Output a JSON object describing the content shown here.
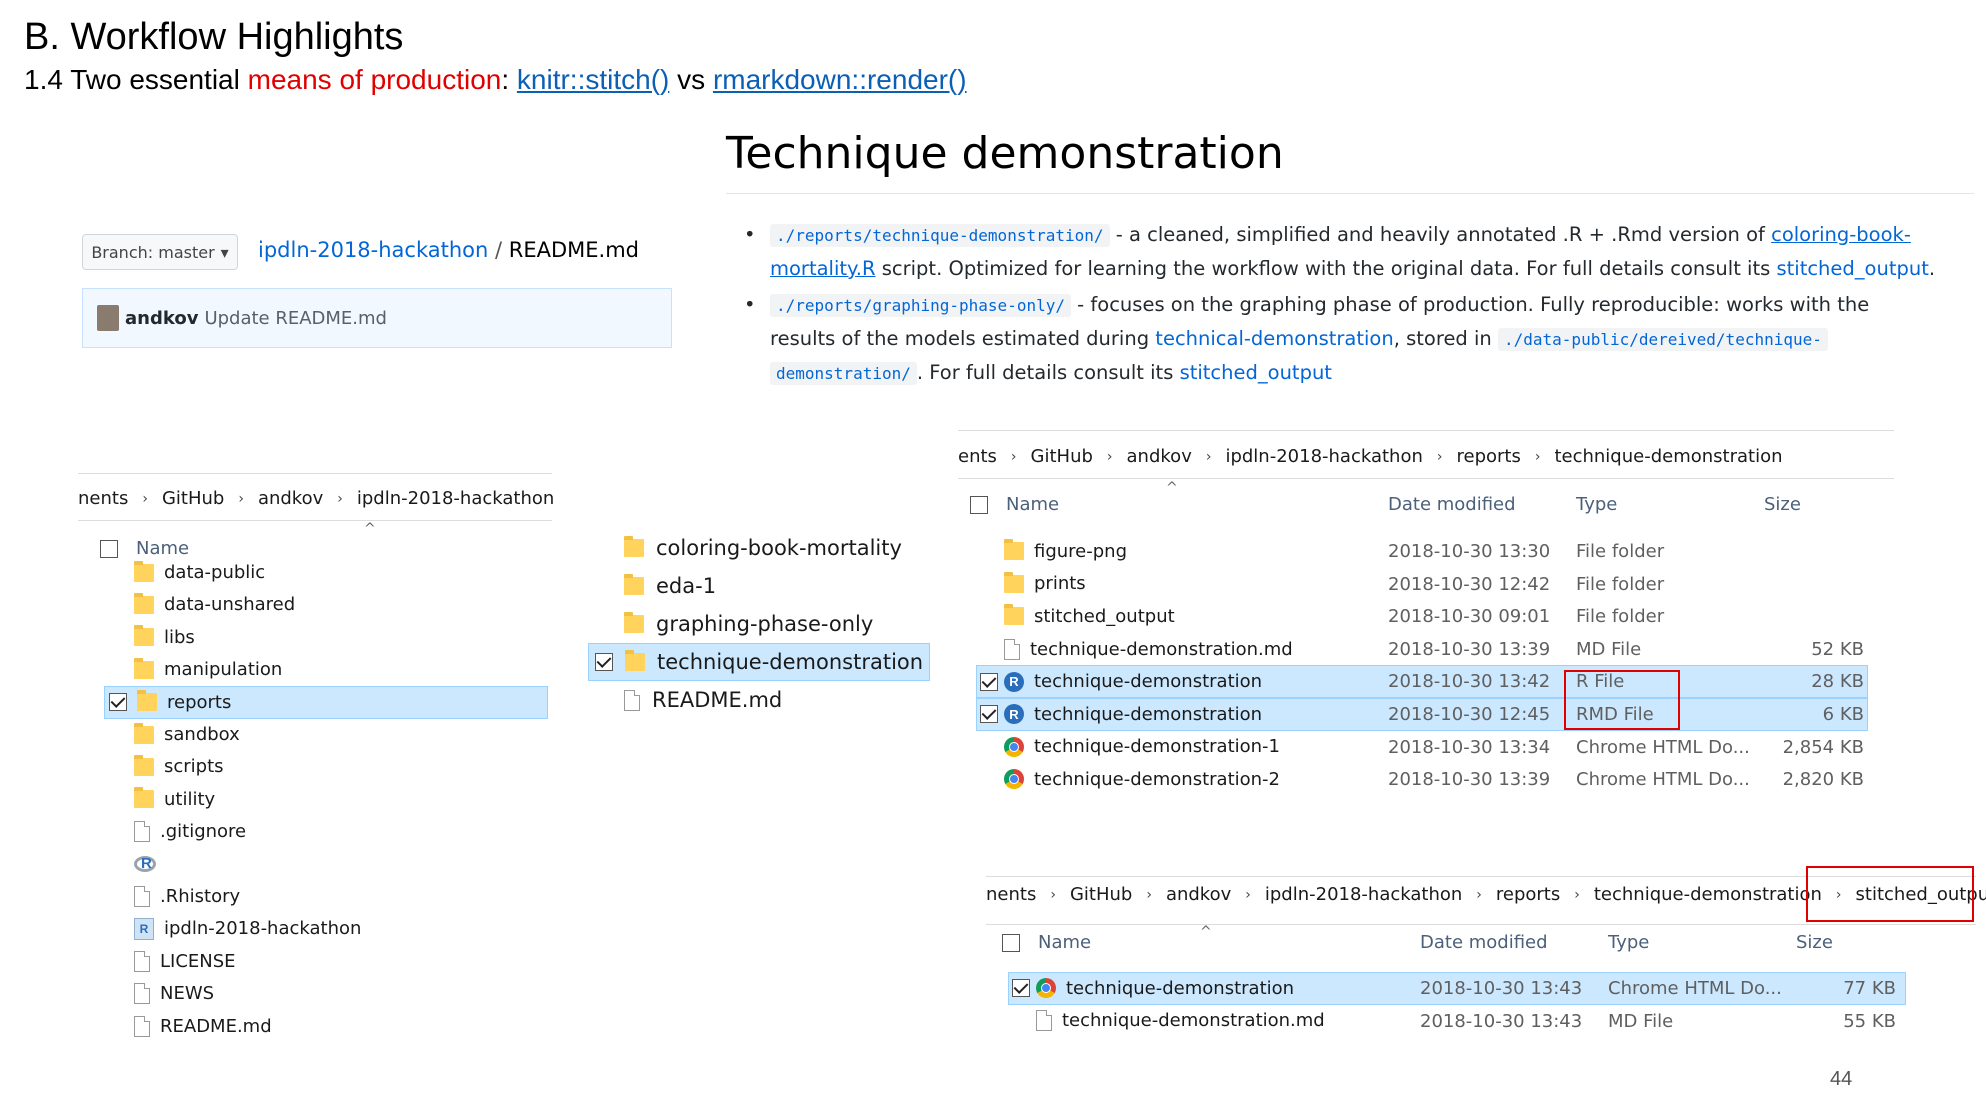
{
  "slide": {
    "title": "B. Workflow Highlights",
    "subtitle_prefix": "1.4 Two essential ",
    "subtitle_red": "means of production",
    "subtitle_colon": ": ",
    "link1": "knitr::stitch()",
    "subtitle_vs": " vs ",
    "link2": "rmarkdown::render()",
    "page_number": "44"
  },
  "github": {
    "branch_label": "Branch: master",
    "repo": "ipdln-2018-hackathon",
    "path_sep": " / ",
    "file": "README.md",
    "commit_user": "andkov",
    "commit_msg": "Update README.md"
  },
  "technique": {
    "title": "Technique demonstration",
    "b1_code": "./reports/technique-demonstration/",
    "b1_text1": " - a cleaned, simplified and heavily annotated .R + .Rmd version of ",
    "b1_link1": "coloring-book-",
    "b1_link2": "mortality.R",
    "b1_text2": " script. Optimized for learning the workflow with the original data. For full details consult its ",
    "b1_link3": "stitched_output",
    "b1_end": ".",
    "b2_code1": "./reports/graphing-phase-only/",
    "b2_text1": " - focuses on the graphing phase of production. Fully reproducible: works with the",
    "b2_text2": "results of the models estimated during ",
    "b2_link1": "technical-demonstration",
    "b2_text3": ", stored in ",
    "b2_code2a": "./data-public/dereived/technique-",
    "b2_code2b": "demonstration/",
    "b2_text4": ". For full details consult its ",
    "b2_link2": "stitched_output"
  },
  "explorer_left": {
    "breadcrumb": [
      "nents",
      "GitHub",
      "andkov",
      "ipdln-2018-hackathon"
    ],
    "col_name": "Name",
    "items": [
      {
        "name": "data-public",
        "icon": "folder"
      },
      {
        "name": "data-unshared",
        "icon": "folder"
      },
      {
        "name": "libs",
        "icon": "folder"
      },
      {
        "name": "manipulation",
        "icon": "folder"
      },
      {
        "name": "reports",
        "icon": "folder",
        "selected": true
      },
      {
        "name": "sandbox",
        "icon": "folder"
      },
      {
        "name": "scripts",
        "icon": "folder"
      },
      {
        "name": "utility",
        "icon": "folder"
      },
      {
        "name": ".gitignore",
        "icon": "file"
      },
      {
        "name": "",
        "icon": "r-logo"
      },
      {
        "name": ".Rhistory",
        "icon": "file"
      },
      {
        "name": "ipdln-2018-hackathon",
        "icon": "rproj"
      },
      {
        "name": "LICENSE",
        "icon": "file"
      },
      {
        "name": "NEWS",
        "icon": "file"
      },
      {
        "name": "README.md",
        "icon": "file"
      }
    ]
  },
  "explorer_mid": {
    "items": [
      {
        "name": "coloring-book-mortality",
        "icon": "folder"
      },
      {
        "name": "eda-1",
        "icon": "folder"
      },
      {
        "name": "graphing-phase-only",
        "icon": "folder"
      },
      {
        "name": "technique-demonstration",
        "icon": "folder",
        "selected": true
      },
      {
        "name": "README.md",
        "icon": "file"
      }
    ]
  },
  "explorer_right": {
    "breadcrumb": [
      "ents",
      "GitHub",
      "andkov",
      "ipdln-2018-hackathon",
      "reports",
      "technique-demonstration"
    ],
    "col_name": "Name",
    "col_date": "Date modified",
    "col_type": "Type",
    "col_size": "Size",
    "rows": [
      {
        "name": "figure-png",
        "icon": "folder",
        "date": "2018-10-30 13:30",
        "type": "File folder",
        "size": ""
      },
      {
        "name": "prints",
        "icon": "folder",
        "date": "2018-10-30 12:42",
        "type": "File folder",
        "size": ""
      },
      {
        "name": "stitched_output",
        "icon": "folder",
        "date": "2018-10-30 09:01",
        "type": "File folder",
        "size": ""
      },
      {
        "name": "technique-demonstration.md",
        "icon": "file",
        "date": "2018-10-30 13:39",
        "type": "MD File",
        "size": "52 KB"
      },
      {
        "name": "technique-demonstration",
        "icon": "r",
        "date": "2018-10-30 13:42",
        "type": "R File",
        "size": "28 KB",
        "selected": true
      },
      {
        "name": "technique-demonstration",
        "icon": "r",
        "date": "2018-10-30 12:45",
        "type": "RMD File",
        "size": "6 KB",
        "selected": true
      },
      {
        "name": "technique-demonstration-1",
        "icon": "chrome",
        "date": "2018-10-30 13:34",
        "type": "Chrome HTML Do...",
        "size": "2,854 KB"
      },
      {
        "name": "technique-demonstration-2",
        "icon": "chrome",
        "date": "2018-10-30 13:39",
        "type": "Chrome HTML Do...",
        "size": "2,820 KB"
      }
    ]
  },
  "explorer_bottom": {
    "breadcrumb": [
      "nents",
      "GitHub",
      "andkov",
      "ipdln-2018-hackathon",
      "reports",
      "technique-demonstration"
    ],
    "breadcrumb_last": "stitched_output",
    "col_name": "Name",
    "col_date": "Date modified",
    "col_type": "Type",
    "col_size": "Size",
    "rows": [
      {
        "name": "technique-demonstration",
        "icon": "chrome",
        "date": "2018-10-30 13:43",
        "type": "Chrome HTML Do...",
        "size": "77 KB",
        "selected": true
      },
      {
        "name": "technique-demonstration.md",
        "icon": "file",
        "date": "2018-10-30 13:43",
        "type": "MD File",
        "size": "55 KB"
      }
    ]
  },
  "colors": {
    "accent_red": "#e00000",
    "link_blue": "#0366d6",
    "selection": "#cce8ff"
  }
}
